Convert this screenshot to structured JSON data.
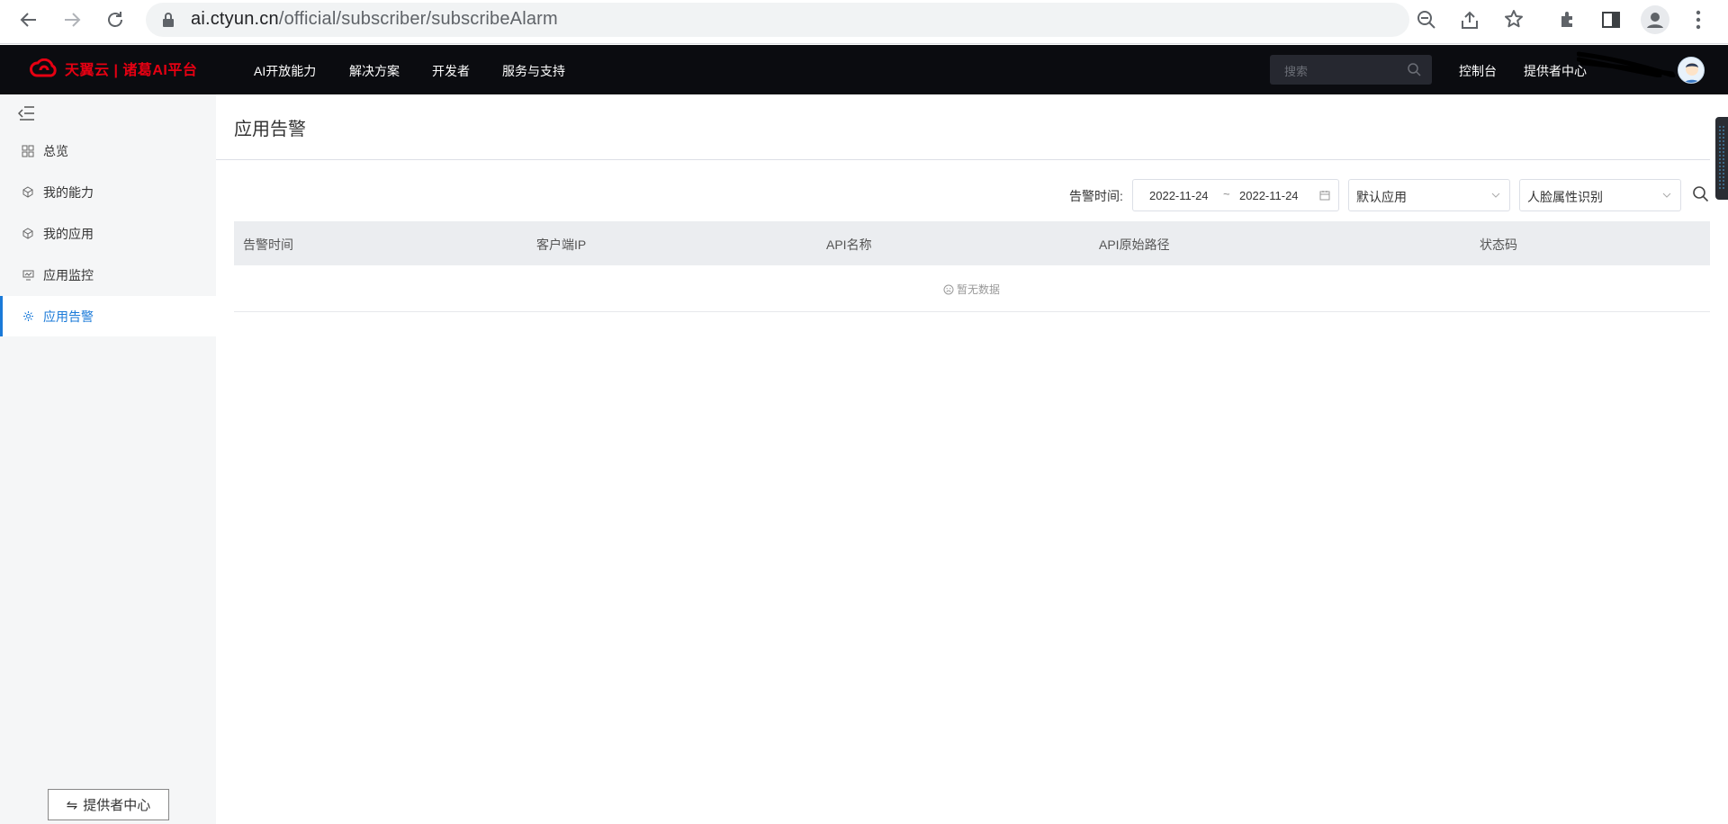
{
  "browser": {
    "url_host": "ai.ctyun.cn",
    "url_path": "/official/subscriber/subscribeAlarm"
  },
  "topnav": {
    "logo_text": "天翼云 | 诸葛AI平台",
    "items": [
      "AI开放能力",
      "解决方案",
      "开发者",
      "服务与支持"
    ],
    "search_placeholder": "搜索",
    "console_link": "控制台",
    "provider_link": "提供者中心"
  },
  "sidebar": {
    "items": [
      {
        "label": "总览",
        "icon": "grid-icon"
      },
      {
        "label": "我的能力",
        "icon": "cube-icon"
      },
      {
        "label": "我的应用",
        "icon": "cube-icon"
      },
      {
        "label": "应用监控",
        "icon": "monitor-icon"
      },
      {
        "label": "应用告警",
        "icon": "gear-icon"
      }
    ],
    "active_index": 4,
    "provider_button": "提供者中心"
  },
  "main": {
    "title": "应用告警",
    "filter_label": "告警时间:",
    "date_start": "2022-11-24",
    "date_sep": "~",
    "date_end": "2022-11-24",
    "app_select": "默认应用",
    "ability_select": "人脸属性识别",
    "table_headers": [
      "告警时间",
      "客户端IP",
      "API名称",
      "API原始路径",
      "状态码"
    ],
    "empty_text": "暂无数据"
  },
  "colors": {
    "accent": "#1a7ad8",
    "nav_bg": "#0b0c10",
    "brand_red": "#e60012"
  }
}
